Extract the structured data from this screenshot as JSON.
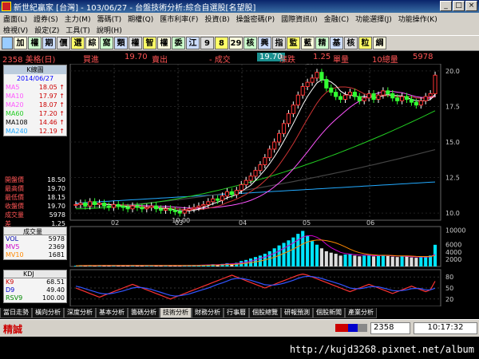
{
  "window": {
    "title": "新世紀贏家 [台灣] - 103/06/27 - 台盤技術分析:綜合自選股[名望股]"
  },
  "menu_row1": [
    "盡面(L)",
    "證券(S)",
    "主力(M)",
    "籌碼(T)",
    "期權(Q)",
    "匯市利率(F)",
    "投資(B)",
    "操盤密碼(P)",
    "國際資訊(I)",
    "金融(C)",
    "功能選擇(J)",
    "功能操作(K)"
  ],
  "menu_row2": [
    "檢視(V)",
    "設定(Z)",
    "工具(T)",
    "說明(H)"
  ],
  "toolbar": [
    "加",
    "權",
    "期",
    "價",
    "選",
    "綜",
    "窩",
    "類",
    "權",
    "智",
    "權",
    "委",
    "江",
    "9",
    "8",
    "29",
    "核",
    "興",
    "指",
    "監",
    "藍",
    "精",
    "基",
    "核",
    "粒",
    "綱"
  ],
  "quote": {
    "code_name": "2358 美格(日)",
    "buy_label": "買進",
    "buy": "19.70",
    "sell_label": "賣出",
    "change_label": "- 成交",
    "last": "19.70",
    "up_label": "漲跌",
    "up": "1.25",
    "vol_label": "單量",
    "vol": "10總量",
    "total": "5978"
  },
  "ma_legend": {
    "header": "K線圖",
    "date": "2014/06/27",
    "rows": [
      {
        "label": "MA5",
        "value": "18.05",
        "color": "#ff55ff"
      },
      {
        "label": "MA10",
        "value": "17.97",
        "color": "#ff55ff"
      },
      {
        "label": "MA20",
        "value": "18.07",
        "color": "#ff55ff"
      },
      {
        "label": "MA60",
        "value": "17.20",
        "color": "#22cc22"
      },
      {
        "label": "MA108",
        "value": "14.46",
        "color": "#000000"
      },
      {
        "label": "MA240",
        "value": "12.19",
        "color": "#22aaff"
      }
    ]
  },
  "price_box": [
    {
      "label": "開盤價",
      "value": "18.50"
    },
    {
      "label": "最高價",
      "value": "19.70"
    },
    {
      "label": "最低價",
      "value": "18.15"
    },
    {
      "label": "收盤價",
      "value": "19.70"
    },
    {
      "label": "成交量",
      "value": "5978"
    },
    {
      "label": "差",
      "value": "1.25"
    }
  ],
  "volume_panel": {
    "title": "成交量",
    "rows": [
      {
        "label": "VOL",
        "value": "5978"
      },
      {
        "label": "MV5",
        "value": "2369"
      },
      {
        "label": "MV10",
        "value": "1681"
      }
    ]
  },
  "kd_panel": {
    "title": "KDJ",
    "rows": [
      {
        "label": "K9",
        "value": "68.51"
      },
      {
        "label": "D9",
        "value": "49.40"
      },
      {
        "label": "RSV9",
        "value": "100.00"
      }
    ]
  },
  "tabs": [
    "當日走勢",
    "橫向分析",
    "深度分析",
    "基本分析",
    "籌碼分析",
    "技術分析",
    "財務分析",
    "行事曆",
    "個股總覽",
    "研報預測",
    "個股新聞",
    "產業分析"
  ],
  "active_tab": "技術分析",
  "status": {
    "mode": "精誠",
    "code": "2358",
    "time": "10:17:32"
  },
  "url_text": "http://kujd3268.pixnet.net/album",
  "chart_data": [
    {
      "type": "candlestick",
      "title": "K線圖",
      "x_labels": [
        "02",
        "03",
        "04",
        "05",
        "06"
      ],
      "y_ticks": [
        10.0,
        12.5,
        15.0,
        17.5,
        20.0
      ],
      "ylim": [
        9.5,
        20.5
      ],
      "annotations": [
        {
          "text": "19.90"
        },
        {
          "text": "10.00"
        }
      ],
      "close": [
        10.6,
        10.7,
        10.5,
        10.8,
        10.6,
        10.7,
        10.5,
        10.4,
        10.6,
        10.5,
        10.4,
        10.3,
        10.5,
        10.4,
        10.3,
        10.4,
        10.5,
        10.3,
        10.2,
        10.3,
        10.2,
        10.1,
        10.0,
        10.2,
        10.3,
        10.4,
        10.5,
        10.6,
        10.8,
        11.0,
        10.9,
        11.2,
        11.5,
        11.3,
        11.6,
        12.0,
        12.3,
        12.6,
        13.0,
        13.4,
        13.9,
        14.5,
        15.0,
        15.6,
        16.3,
        17.0,
        17.6,
        18.3,
        18.9,
        19.2,
        19.5,
        19.9,
        19.4,
        18.8,
        18.5,
        18.2,
        18.0,
        18.3,
        18.5,
        18.2,
        17.9,
        18.1,
        18.4,
        18.0,
        18.3,
        18.6,
        18.4,
        18.1,
        17.9,
        18.2,
        18.0,
        17.8,
        17.6,
        17.9,
        18.2,
        18.4,
        19.7
      ],
      "ma5_last": 18.05,
      "ma60_last": 17.2,
      "ma108_last": 14.46,
      "ma240_last": 12.19
    },
    {
      "type": "bar",
      "title": "成交量",
      "y_ticks": [
        2000,
        4000,
        6000,
        10000
      ],
      "ylim": [
        0,
        11000
      ],
      "values": [
        200,
        300,
        250,
        280,
        220,
        300,
        260,
        240,
        300,
        280,
        260,
        250,
        300,
        270,
        260,
        250,
        300,
        280,
        270,
        250,
        260,
        240,
        230,
        300,
        350,
        380,
        400,
        420,
        500,
        600,
        550,
        700,
        900,
        800,
        1000,
        1500,
        1800,
        2200,
        2600,
        3000,
        3500,
        4200,
        5000,
        5800,
        6500,
        7200,
        8000,
        9000,
        9800,
        8500,
        7000,
        6000,
        5000,
        4200,
        3800,
        3500,
        3000,
        3300,
        3500,
        3000,
        2800,
        3000,
        3200,
        2800,
        3000,
        3200,
        2900,
        2700,
        2600,
        2900,
        2800,
        2500,
        2400,
        2600,
        2800,
        3000,
        5978
      ]
    },
    {
      "type": "line",
      "title": "KDJ",
      "y_ticks": [
        20,
        50,
        80
      ],
      "ylim": [
        0,
        100
      ],
      "series": [
        {
          "name": "K9",
          "color": "#ff3333",
          "values": [
            50,
            45,
            40,
            35,
            30,
            25,
            30,
            35,
            40,
            45,
            50,
            55,
            60,
            55,
            50,
            45,
            40,
            35,
            30,
            25,
            20,
            25,
            30,
            35,
            40,
            45,
            50,
            55,
            60,
            65,
            70,
            75,
            80,
            85,
            80,
            75,
            70,
            65,
            60,
            55,
            50,
            55,
            60,
            65,
            70,
            75,
            80,
            85,
            88,
            85,
            80,
            75,
            70,
            65,
            60,
            55,
            50,
            45,
            40,
            45,
            50,
            55,
            60,
            55,
            50,
            45,
            40,
            35,
            40,
            45,
            50,
            55,
            50,
            45,
            40,
            45,
            68.51
          ]
        },
        {
          "name": "D9",
          "color": "#3355ff",
          "values": [
            55,
            52,
            48,
            44,
            40,
            36,
            34,
            34,
            36,
            39,
            42,
            46,
            50,
            52,
            51,
            49,
            46,
            42,
            38,
            34,
            30,
            28,
            29,
            31,
            34,
            38,
            42,
            46,
            50,
            55,
            60,
            64,
            69,
            74,
            76,
            76,
            74,
            71,
            67,
            63,
            59,
            58,
            58,
            60,
            63,
            67,
            71,
            76,
            80,
            82,
            81,
            79,
            76,
            72,
            68,
            64,
            60,
            55,
            50,
            48,
            48,
            50,
            53,
            54,
            53,
            50,
            47,
            43,
            42,
            43,
            45,
            48,
            49,
            48,
            45,
            45,
            49.4
          ]
        }
      ]
    }
  ]
}
